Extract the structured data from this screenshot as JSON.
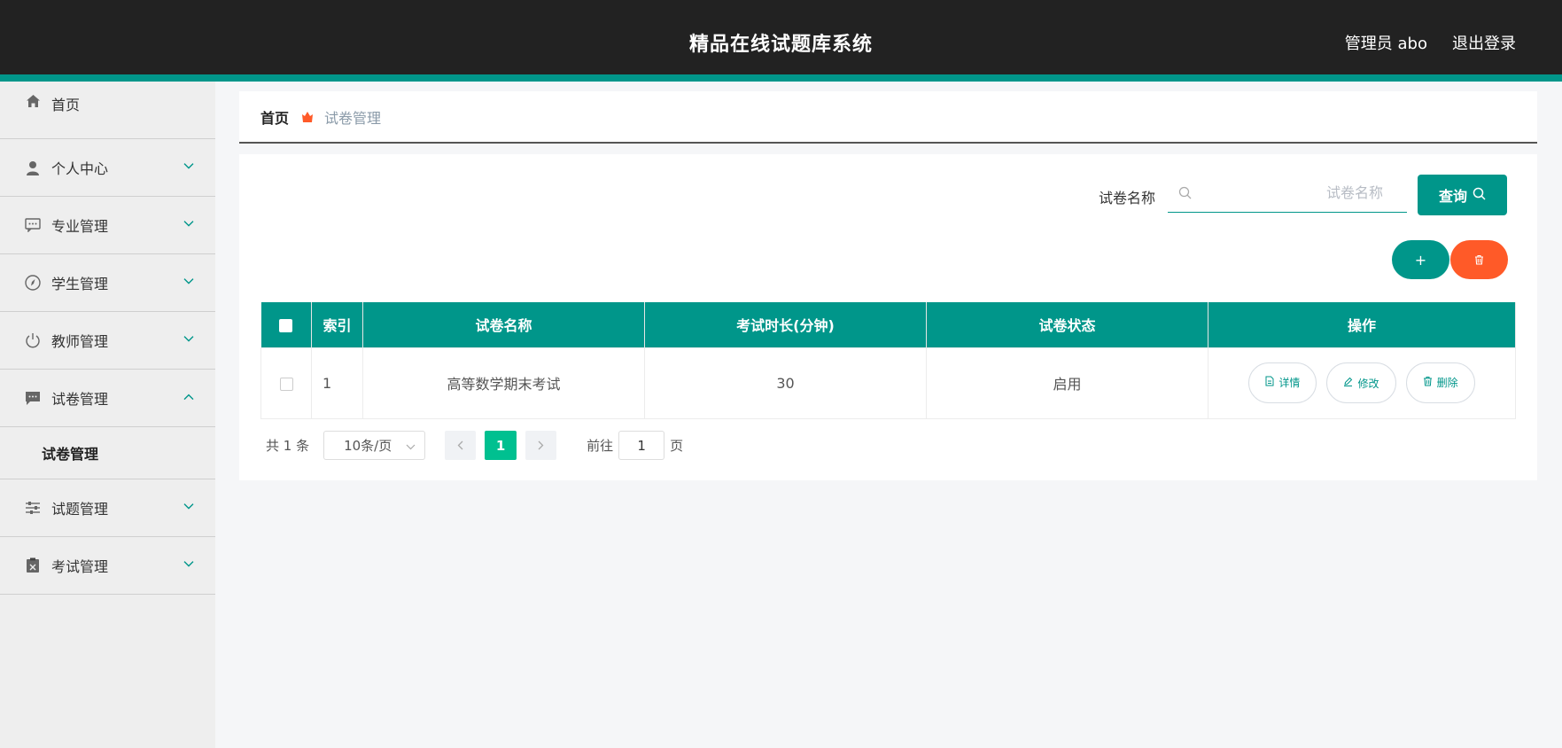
{
  "header": {
    "title": "精品在线试题库系统",
    "user": "管理员 abo",
    "logout": "退出登录"
  },
  "sidebar": {
    "items": [
      {
        "label": "首页",
        "icon": "home-icon"
      },
      {
        "label": "个人中心",
        "icon": "user-icon"
      },
      {
        "label": "专业管理",
        "icon": "chat-icon"
      },
      {
        "label": "学生管理",
        "icon": "compass-icon"
      },
      {
        "label": "教师管理",
        "icon": "power-icon"
      },
      {
        "label": "试卷管理",
        "icon": "message-icon",
        "expanded": true,
        "children": [
          "试卷管理"
        ]
      },
      {
        "label": "试题管理",
        "icon": "sliders-icon"
      },
      {
        "label": "考试管理",
        "icon": "clipboard-icon"
      }
    ]
  },
  "breadcrumb": {
    "home": "首页",
    "current": "试卷管理"
  },
  "search": {
    "label": "试卷名称",
    "placeholder": "试卷名称",
    "value": "",
    "button": "查询"
  },
  "actions": {
    "add": "+",
    "delete_icon": "trash-icon"
  },
  "table": {
    "columns": [
      "索引",
      "试卷名称",
      "考试时长(分钟)",
      "试卷状态",
      "操作"
    ],
    "rows": [
      {
        "index": "1",
        "name": "高等数学期末考试",
        "duration": "30",
        "status": "启用"
      }
    ],
    "ops": {
      "detail": "详情",
      "edit": "修改",
      "remove": "删除"
    }
  },
  "pagination": {
    "total": "共 1 条",
    "page_size": "10条/页",
    "current": "1",
    "goto_label": "前往",
    "goto_value": "1",
    "page_suffix": "页"
  },
  "colors": {
    "primary": "#00968a",
    "danger": "#ff5a28",
    "header_bg": "#222222"
  }
}
